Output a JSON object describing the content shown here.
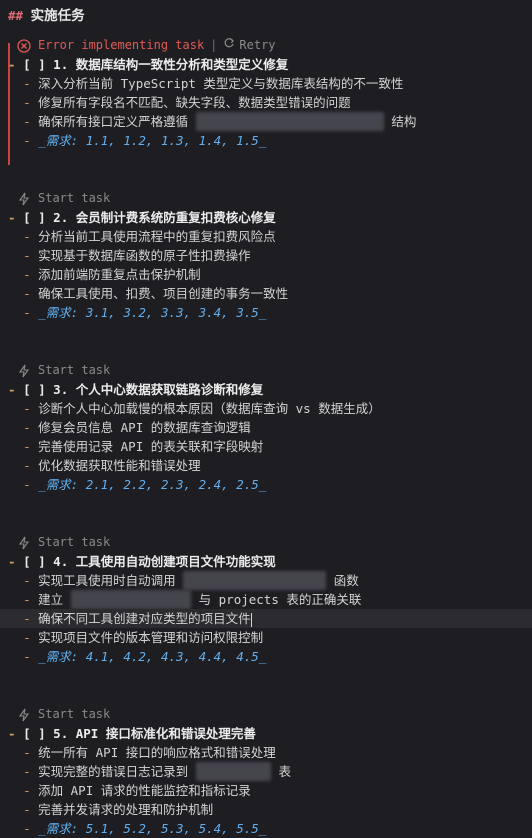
{
  "heading": {
    "hash": "##",
    "title": "实施任务"
  },
  "codelens": {
    "error_text": "Error implementing task",
    "retry_label": "Retry",
    "start_label": "Start task"
  },
  "tasks": [
    {
      "title": "[ ] 1. 数据库结构一致性分析和类型定义修复",
      "items": [
        "深入分析当前 TypeScript 类型定义与数据库表结构的不一致性",
        "修复所有字段名不匹配、缺失字段、数据类型错误的问题",
        "确保所有接口定义严格遵循",
        "结构"
      ],
      "ref": "_需求: 1.1, 1.2, 1.3, 1.4, 1.5_"
    },
    {
      "title": "[ ] 2. 会员制计费系统防重复扣费核心修复",
      "items": [
        "分析当前工具使用流程中的重复扣费风险点",
        "实现基于数据库函数的原子性扣费操作",
        "添加前端防重复点击保护机制",
        "确保工具使用、扣费、项目创建的事务一致性"
      ],
      "ref": "_需求: 3.1, 3.2, 3.3, 3.4, 3.5_"
    },
    {
      "title": "[ ] 3. 个人中心数据获取链路诊断和修复",
      "items": [
        "诊断个人中心加载慢的根本原因（数据库查询 vs 数据生成）",
        "修复会员信息 API 的数据库查询逻辑",
        "完善使用记录 API 的表关联和字段映射",
        "优化数据获取性能和错误处理"
      ],
      "ref": "_需求: 2.1, 2.2, 2.3, 2.4, 2.5_"
    },
    {
      "title": "[ ] 4. 工具使用自动创建项目文件功能实现",
      "items": [
        "实现工具使用时自动调用",
        "函数",
        "建立",
        "与 projects 表的正确关联",
        "确保不同工具创建对应类型的项目文件",
        "实现项目文件的版本管理和访问权限控制"
      ],
      "ref": "_需求: 4.1, 4.2, 4.3, 4.4, 4.5_"
    },
    {
      "title": "[ ] 5. API 接口标准化和错误处理完善",
      "items": [
        "统一所有 API 接口的响应格式和错误处理",
        "实现完整的错误日志记录到",
        "表",
        "添加 API 请求的性能监控和指标记录",
        "完善并发请求的处理和防护机制"
      ],
      "ref": "_需求: 5.1, 5.2, 5.3, 5.4, 5.5_"
    }
  ],
  "colors": {
    "background": "#1e1e22",
    "dash": "#d19a66",
    "ref": "#61afef",
    "error": "#e05a55"
  }
}
